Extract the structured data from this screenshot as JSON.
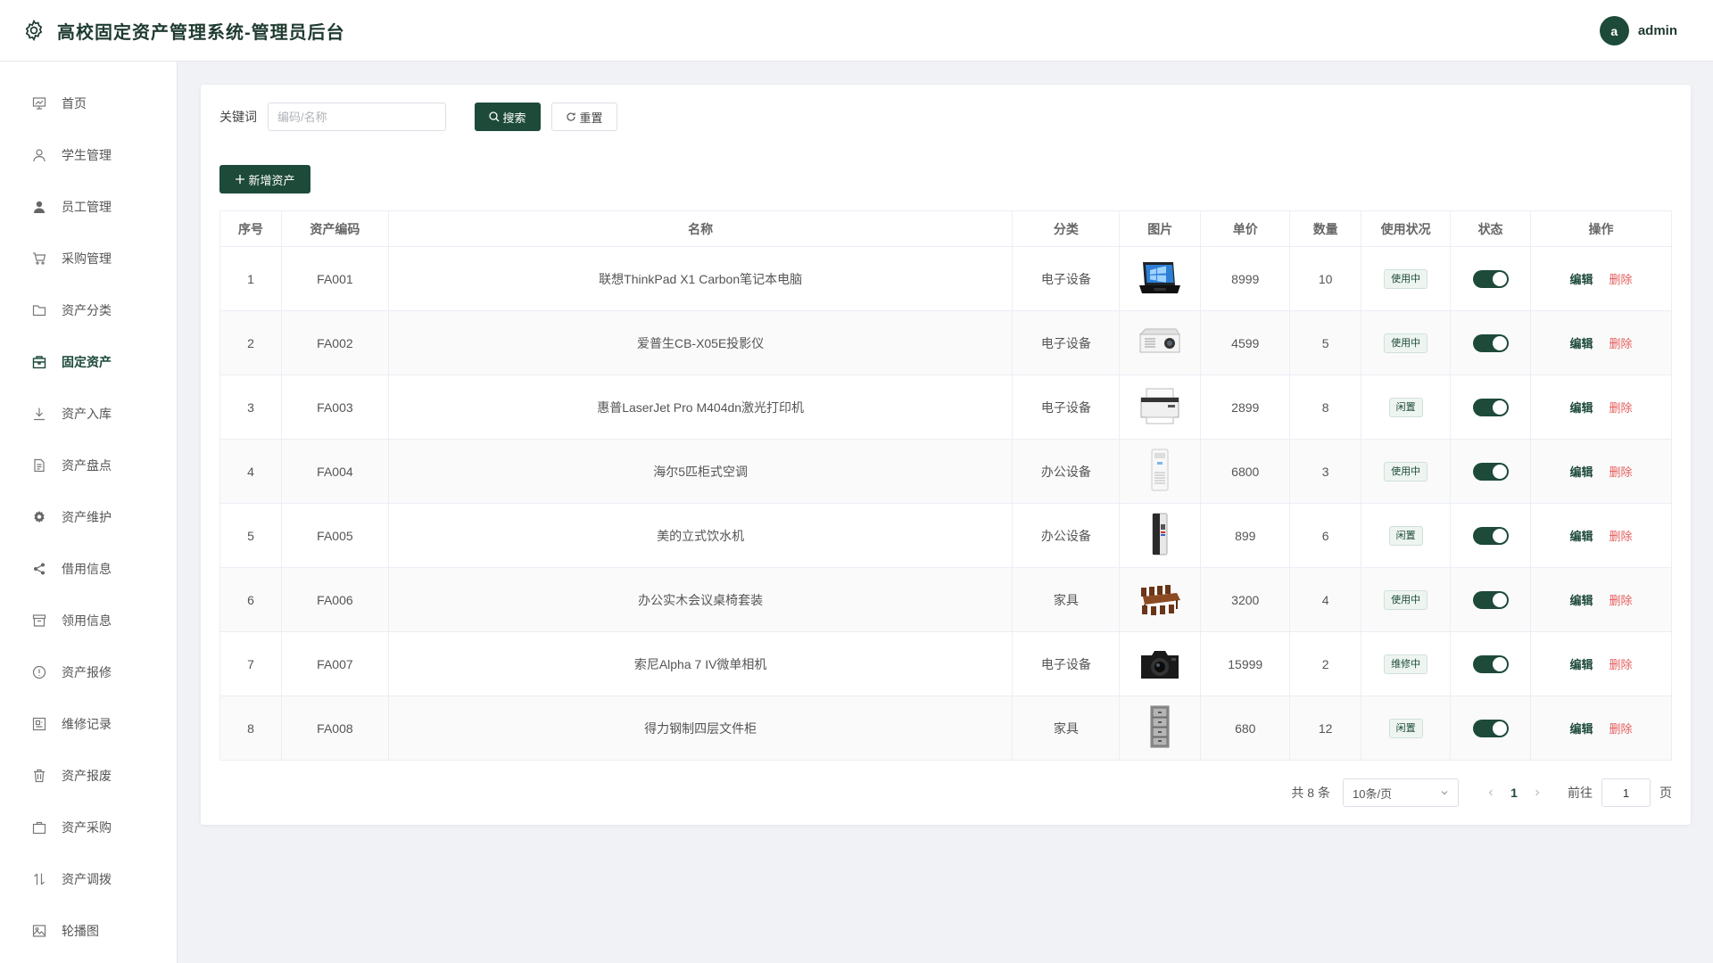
{
  "header": {
    "title": "高校固定资产管理系统-管理员后台",
    "logo_icon": "gear-icon",
    "avatar_letter": "a",
    "username": "admin"
  },
  "sidebar": {
    "items": [
      {
        "label": "首页",
        "icon": "chart-board-icon",
        "active": false
      },
      {
        "label": "学生管理",
        "icon": "user-outline-icon",
        "active": false
      },
      {
        "label": "员工管理",
        "icon": "user-filled-icon",
        "active": false
      },
      {
        "label": "采购管理",
        "icon": "cart-icon",
        "active": false
      },
      {
        "label": "资产分类",
        "icon": "folder-icon",
        "active": false
      },
      {
        "label": "固定资产",
        "icon": "box-icon",
        "active": true
      },
      {
        "label": "资产入库",
        "icon": "download-icon",
        "active": false
      },
      {
        "label": "资产盘点",
        "icon": "document-icon",
        "active": false
      },
      {
        "label": "资产维护",
        "icon": "cog-icon",
        "active": false
      },
      {
        "label": "借用信息",
        "icon": "share-icon",
        "active": false
      },
      {
        "label": "领用信息",
        "icon": "archive-icon",
        "active": false
      },
      {
        "label": "资产报修",
        "icon": "warning-circle-icon",
        "active": false
      },
      {
        "label": "维修记录",
        "icon": "record-icon",
        "active": false
      },
      {
        "label": "资产报废",
        "icon": "trash-icon",
        "active": false
      },
      {
        "label": "资产采购",
        "icon": "bag-icon",
        "active": false
      },
      {
        "label": "资产调拨",
        "icon": "transfer-icon",
        "active": false
      },
      {
        "label": "轮播图",
        "icon": "image-icon",
        "active": false
      }
    ]
  },
  "search": {
    "label": "关键词",
    "placeholder": "编码/名称",
    "value": "",
    "search_button": "搜索",
    "reset_button": "重置"
  },
  "toolbar": {
    "add_button": "新增资产"
  },
  "table": {
    "columns": [
      "序号",
      "资产编码",
      "名称",
      "分类",
      "图片",
      "单价",
      "数量",
      "使用状况",
      "状态",
      "操作"
    ],
    "edit_label": "编辑",
    "delete_label": "删除",
    "rows": [
      {
        "no": "1",
        "code": "FA001",
        "name": "联想ThinkPad X1 Carbon笔记本电脑",
        "category": "电子设备",
        "image": "laptop",
        "price": "8999",
        "qty": "10",
        "usage": "使用中",
        "enabled": true
      },
      {
        "no": "2",
        "code": "FA002",
        "name": "爱普生CB-X05E投影仪",
        "category": "电子设备",
        "image": "projector",
        "price": "4599",
        "qty": "5",
        "usage": "使用中",
        "enabled": true
      },
      {
        "no": "3",
        "code": "FA003",
        "name": "惠普LaserJet Pro M404dn激光打印机",
        "category": "电子设备",
        "image": "printer",
        "price": "2899",
        "qty": "8",
        "usage": "闲置",
        "enabled": true
      },
      {
        "no": "4",
        "code": "FA004",
        "name": "海尔5匹柜式空调",
        "category": "办公设备",
        "image": "air-conditioner",
        "price": "6800",
        "qty": "3",
        "usage": "使用中",
        "enabled": true
      },
      {
        "no": "5",
        "code": "FA005",
        "name": "美的立式饮水机",
        "category": "办公设备",
        "image": "water-dispenser",
        "price": "899",
        "qty": "6",
        "usage": "闲置",
        "enabled": true
      },
      {
        "no": "6",
        "code": "FA006",
        "name": "办公实木会议桌椅套装",
        "category": "家具",
        "image": "conference-table",
        "price": "3200",
        "qty": "4",
        "usage": "使用中",
        "enabled": true
      },
      {
        "no": "7",
        "code": "FA007",
        "name": "索尼Alpha 7 IV微单相机",
        "category": "电子设备",
        "image": "camera",
        "price": "15999",
        "qty": "2",
        "usage": "维修中",
        "enabled": true
      },
      {
        "no": "8",
        "code": "FA008",
        "name": "得力钢制四层文件柜",
        "category": "家具",
        "image": "file-cabinet",
        "price": "680",
        "qty": "12",
        "usage": "闲置",
        "enabled": true
      }
    ]
  },
  "pagination": {
    "total_text": "共 8 条",
    "page_size": "10条/页",
    "current_page": "1",
    "goto_label": "前往",
    "goto_value": "1",
    "page_suffix": "页"
  },
  "colors": {
    "primary": "#1d4a39",
    "danger": "#e65b5b"
  }
}
